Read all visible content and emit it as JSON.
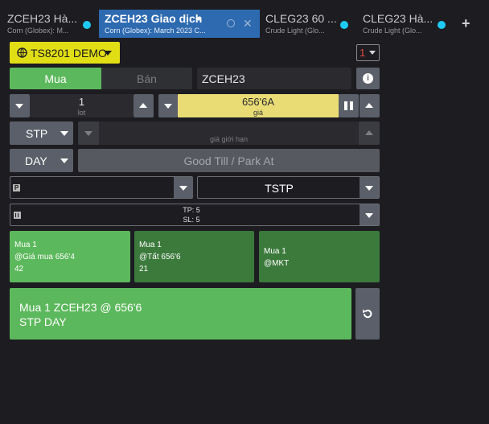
{
  "tabs": [
    {
      "title": "ZCEH23 Hà...",
      "subtitle": "Corn (Globex): M..."
    },
    {
      "title": "ZCEH23 Giao dịch",
      "subtitle": "Corn (Globex): March 2023 C..."
    },
    {
      "title": "CLEG23 60 ...",
      "subtitle": "Crude Light (Glo..."
    },
    {
      "title": "CLEG23 Hà...",
      "subtitle": "Crude Light (Glo..."
    }
  ],
  "account": {
    "label": "TS8201 DEMO"
  },
  "counter": {
    "value": "1"
  },
  "side": {
    "buy": "Mua",
    "sell": "Bán"
  },
  "symbol": {
    "value": "ZCEH23"
  },
  "quantity": {
    "value": "1",
    "unit": "lot"
  },
  "price": {
    "value": "656'6A",
    "label": "giá"
  },
  "order_type": {
    "value": "STP"
  },
  "limit_price": {
    "placeholder": "giá giới hạn"
  },
  "duration": {
    "value": "DAY",
    "good_till": "Good Till / Park At"
  },
  "bracket": {
    "mode": "TSTP",
    "tp": "TP: 5",
    "sl": "SL: 5"
  },
  "quick_orders": [
    {
      "line1": "Mua 1",
      "line2": "@Giá mua 656'4",
      "line3": "42"
    },
    {
      "line1": "Mua 1",
      "line2": "@Tất 656'6",
      "line3": "21"
    },
    {
      "line1": "Mua 1",
      "line2": "@MKT",
      "line3": ""
    }
  ],
  "submit": {
    "line1": "Mua 1 ZCEH23 @ 656'6",
    "line2": "STP DAY"
  },
  "colors": {
    "accent": "#2e6ab0",
    "buy": "#5cb85c",
    "price_bg": "#e9dc75",
    "account_bg": "#e2de16",
    "dot": "#1fc9f5"
  }
}
